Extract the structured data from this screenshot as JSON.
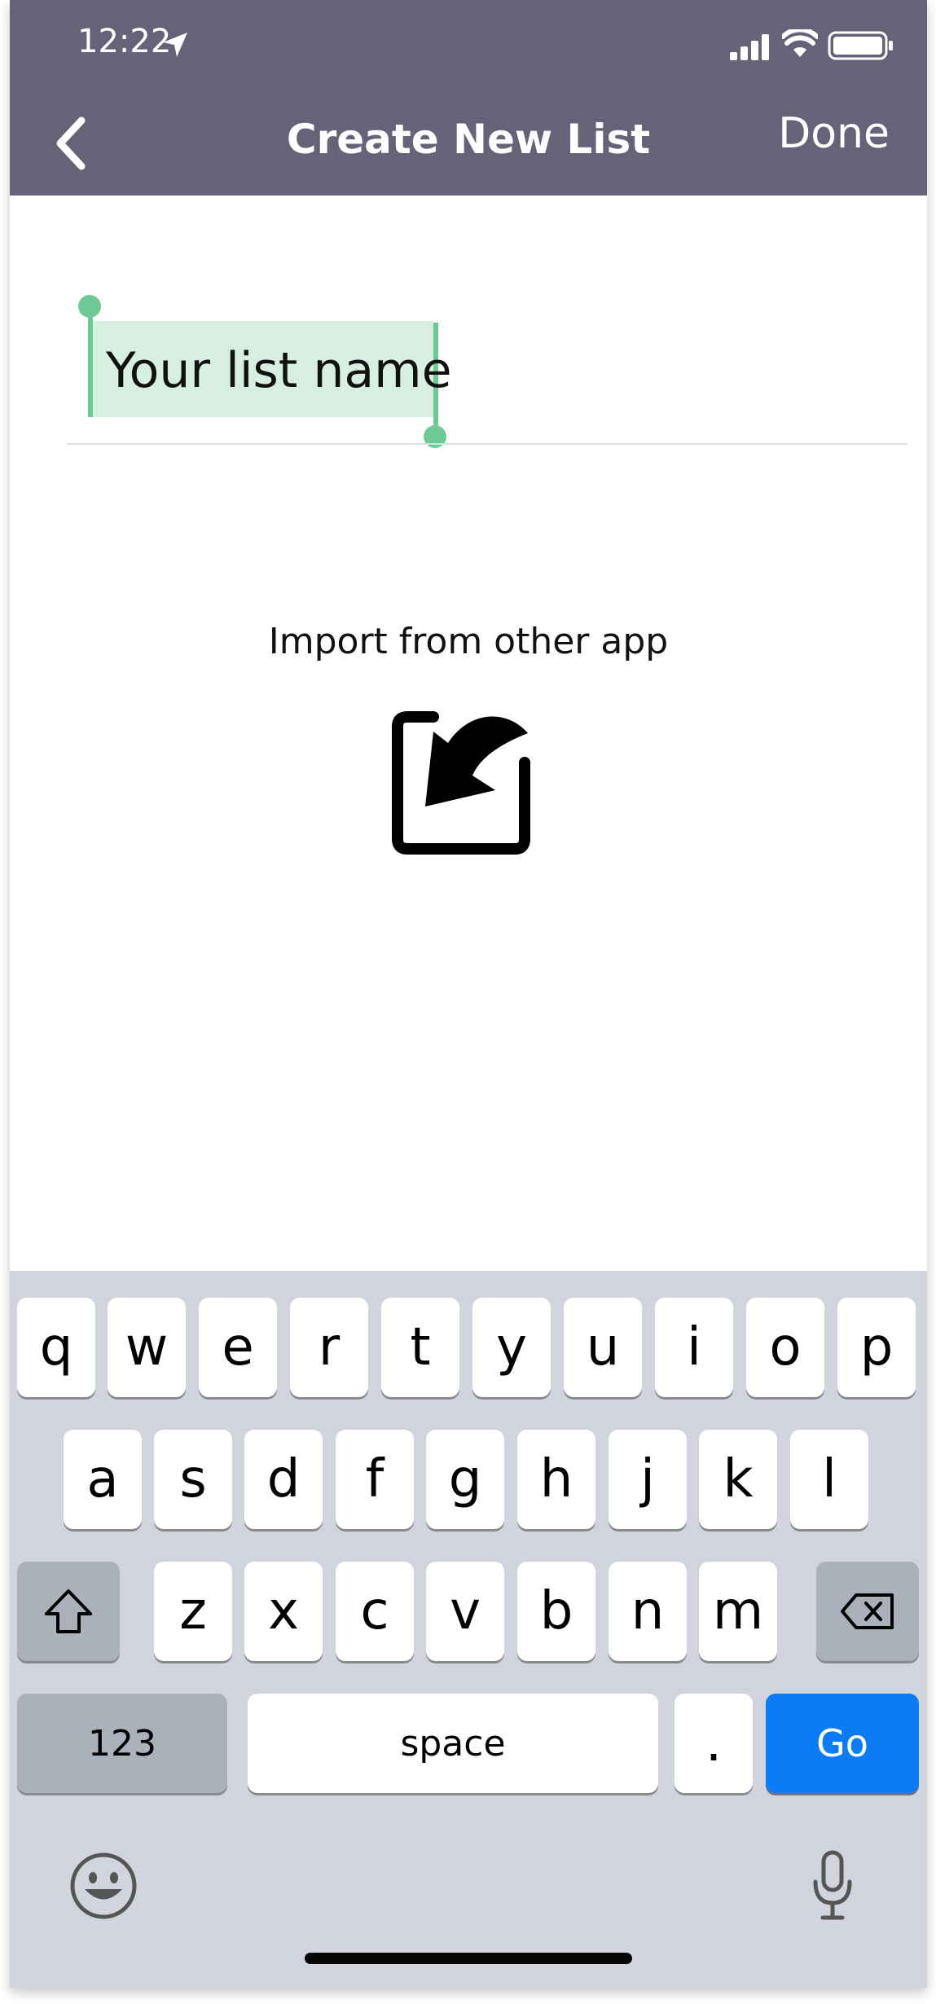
{
  "status_bar": {
    "time": "12:22"
  },
  "nav": {
    "title": "Create New List",
    "done_label": "Done"
  },
  "list_name_field": {
    "value": "Your list name"
  },
  "import": {
    "label": "Import from other app"
  },
  "keyboard": {
    "row1": [
      "q",
      "w",
      "e",
      "r",
      "t",
      "y",
      "u",
      "i",
      "o",
      "p"
    ],
    "row2": [
      "a",
      "s",
      "d",
      "f",
      "g",
      "h",
      "j",
      "k",
      "l"
    ],
    "row3": [
      "z",
      "x",
      "c",
      "v",
      "b",
      "n",
      "m"
    ],
    "numbers_label": "123",
    "space_label": "space",
    "period_label": ".",
    "go_label": "Go"
  },
  "colors": {
    "nav_bar": "#646377",
    "selection": "#d6efe1",
    "selection_handle": "#6fc995",
    "go_key": "#0b7cf5",
    "keyboard_bg": "#d1d4dc"
  }
}
